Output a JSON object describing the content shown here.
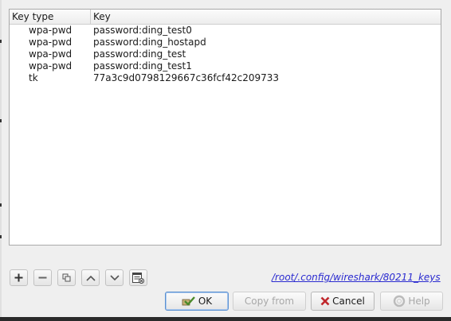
{
  "table": {
    "columns": [
      "Key type",
      "Key"
    ],
    "rows": [
      {
        "type": "wpa-pwd",
        "key": "password:ding_test0"
      },
      {
        "type": "wpa-pwd",
        "key": "password:ding_hostapd"
      },
      {
        "type": "wpa-pwd",
        "key": "password:ding_test"
      },
      {
        "type": "wpa-pwd",
        "key": "password:ding_test1"
      },
      {
        "type": "tk",
        "key": "77a3c9d0798129667c36fcf42c209733"
      }
    ]
  },
  "toolbar": {
    "add_icon": "plus-icon",
    "remove_icon": "minus-icon",
    "copy_icon": "copy-icon",
    "up_icon": "chevron-up-icon",
    "down_icon": "chevron-down-icon",
    "clear_icon": "clear-list-icon"
  },
  "file_path": "/root/.config/wireshark/80211_keys",
  "buttons": {
    "ok": "OK",
    "copy_from": "Copy from",
    "cancel": "Cancel",
    "help": "Help"
  },
  "colors": {
    "link": "#2a2ad0",
    "cancel_icon": "#c0282d",
    "ok_icon": "#4a8a2a"
  }
}
